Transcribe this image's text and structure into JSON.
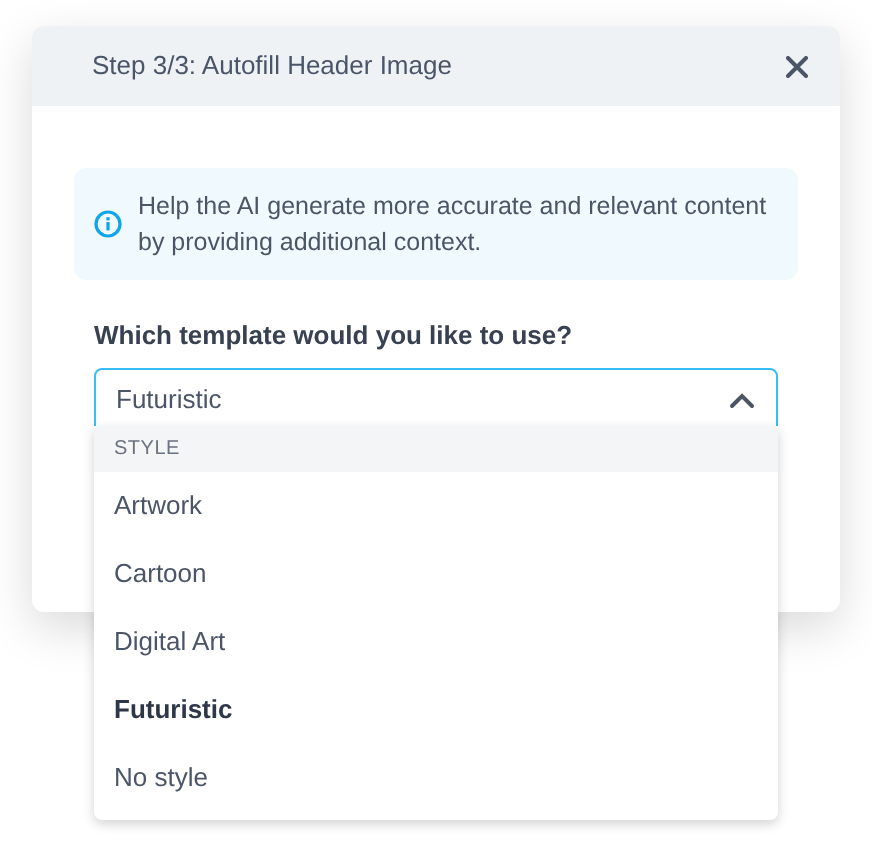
{
  "dialog": {
    "title": "Step 3/3: Autofill Header Image",
    "info": "Help the AI generate more accurate and relevant content by providing additional context.",
    "field_label": "Which template would you like to use?",
    "select": {
      "value": "Futuristic",
      "expanded": true
    },
    "dropdown": {
      "group_label": "STYLE",
      "options": [
        {
          "label": "Artwork",
          "selected": false
        },
        {
          "label": "Cartoon",
          "selected": false
        },
        {
          "label": "Digital Art",
          "selected": false
        },
        {
          "label": "Futuristic",
          "selected": true
        },
        {
          "label": "No style",
          "selected": false
        }
      ]
    }
  }
}
